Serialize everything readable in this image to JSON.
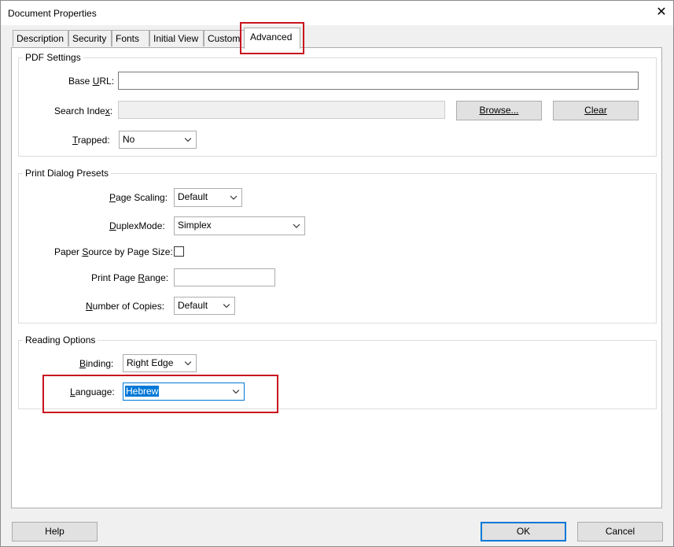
{
  "window": {
    "title": "Document Properties"
  },
  "tabs": [
    {
      "label": "Description",
      "active": false
    },
    {
      "label": "Security",
      "active": false
    },
    {
      "label": "Fonts",
      "active": false
    },
    {
      "label": "Initial View",
      "active": false
    },
    {
      "label": "Custom",
      "active": false
    },
    {
      "label": "Advanced",
      "active": true
    }
  ],
  "pdf_settings": {
    "title": "PDF Settings",
    "base_url": {
      "label": "Base URL:",
      "value": ""
    },
    "search_index": {
      "label": "Search Index:",
      "value": ""
    },
    "browse_label": "Browse...",
    "clear_label": "Clear",
    "trapped": {
      "label": "Trapped:",
      "value": "No"
    }
  },
  "print_presets": {
    "title": "Print Dialog Presets",
    "page_scaling": {
      "label": "Page Scaling:",
      "value": "Default"
    },
    "duplex_mode": {
      "label": "DuplexMode:",
      "value": "Simplex"
    },
    "paper_source": {
      "label": "Paper Source by Page Size:",
      "checked": false
    },
    "print_page_range": {
      "label": "Print Page Range:",
      "value": ""
    },
    "number_of_copies": {
      "label": "Number of Copies:",
      "value": "Default"
    }
  },
  "reading_options": {
    "title": "Reading Options",
    "binding": {
      "label": "Binding:",
      "value": "Right Edge"
    },
    "language": {
      "label": "Language:",
      "value": "Hebrew"
    }
  },
  "footer": {
    "help_label": "Help",
    "ok_label": "OK",
    "cancel_label": "Cancel"
  },
  "colors": {
    "highlight": "#c8141e",
    "selection": "#0078d7"
  }
}
